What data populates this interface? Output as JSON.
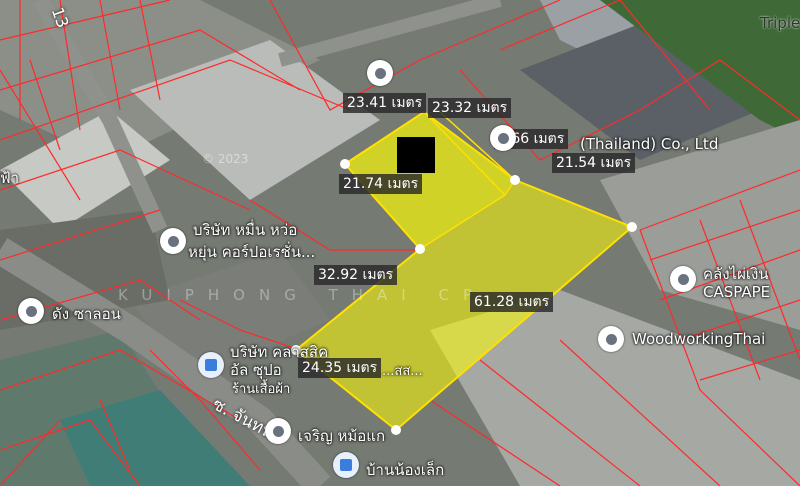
{
  "measurements": [
    "23.41 เมตร",
    "23.32 เมตร",
    "9.66 เมตร",
    "21.54 เมตร",
    "21.74 เมตร",
    "32.92 เมตร",
    "61.28 เมตร",
    "24.35 เมตร"
  ],
  "places": {
    "company_thailand": "(Thailand) Co., Ltd",
    "company_a_line1": "บริษัท หมื่น หว่อ",
    "company_a_line2": "หยุ่น คอร์ปอเรชั่น...",
    "dang": "ดัง ซาลอน",
    "company_b_line1": "บริษัท คลาสสิค",
    "company_b_line2": "อัล ซุปอ",
    "clothes_shop": "ร้านเสื้อผ้า",
    "charoen": "เจริญ หม้อแก",
    "ban_nong_lek": "บ้านน้องเล็ก",
    "warehouse": "คลังไผ่เงิน",
    "caspaper": "CASPAPE",
    "woodworking": "WoodworkingThai",
    "triple": "Triple",
    "fa": "ฟ้า"
  },
  "streets": {
    "soi_number": "13",
    "soi_name": "ซ. จันทน์"
  },
  "labels": {
    "land_label": "...สส...",
    "copyright": "© 2023",
    "watermark": "KUIPHONG THAI CP"
  }
}
